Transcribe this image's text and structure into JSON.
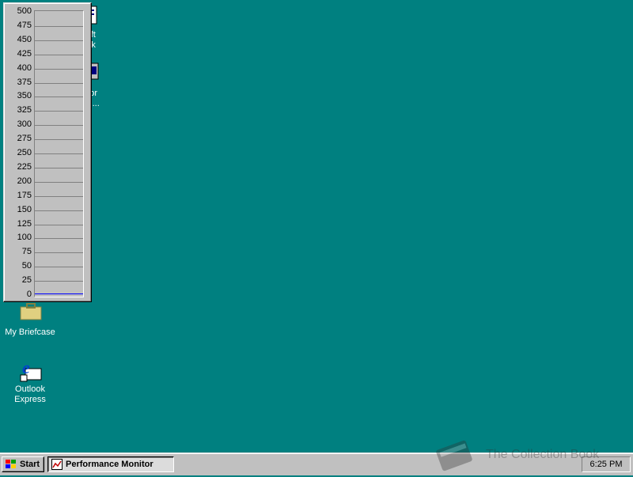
{
  "desktop": {
    "icons": [
      {
        "label_line1": "soft",
        "label_line2": "ook",
        "icon": "book-icon"
      },
      {
        "label_line1": "p for",
        "label_line2": "oft I...",
        "icon": "setup-icon"
      },
      {
        "label_line1": "My Briefcase",
        "icon": "briefcase-icon"
      },
      {
        "label_line1": "Outlook",
        "label_line2": "Express",
        "icon": "outlook-express-icon"
      }
    ],
    "background_color": "#008080"
  },
  "perf_monitor": {
    "ticks": [
      "500",
      "475",
      "450",
      "425",
      "400",
      "375",
      "350",
      "325",
      "300",
      "275",
      "250",
      "225",
      "200",
      "175",
      "150",
      "125",
      "100",
      "75",
      "50",
      "25",
      "0"
    ]
  },
  "chart_data": {
    "type": "line",
    "ylim": [
      0,
      500
    ],
    "yticks": [
      500,
      475,
      450,
      425,
      400,
      375,
      350,
      325,
      300,
      275,
      250,
      225,
      200,
      175,
      150,
      125,
      100,
      75,
      50,
      25,
      0
    ],
    "series": [
      {
        "values": [
          0,
          0
        ]
      }
    ],
    "grid": true,
    "line_color": "#0000ff"
  },
  "taskbar": {
    "start_label": "Start",
    "tasks": [
      {
        "label": "Performance Monitor",
        "icon": "perfmon-icon"
      }
    ],
    "clock": "6:25 PM"
  },
  "watermark": {
    "text": "The Collection Book",
    "icon": "book-icon"
  }
}
